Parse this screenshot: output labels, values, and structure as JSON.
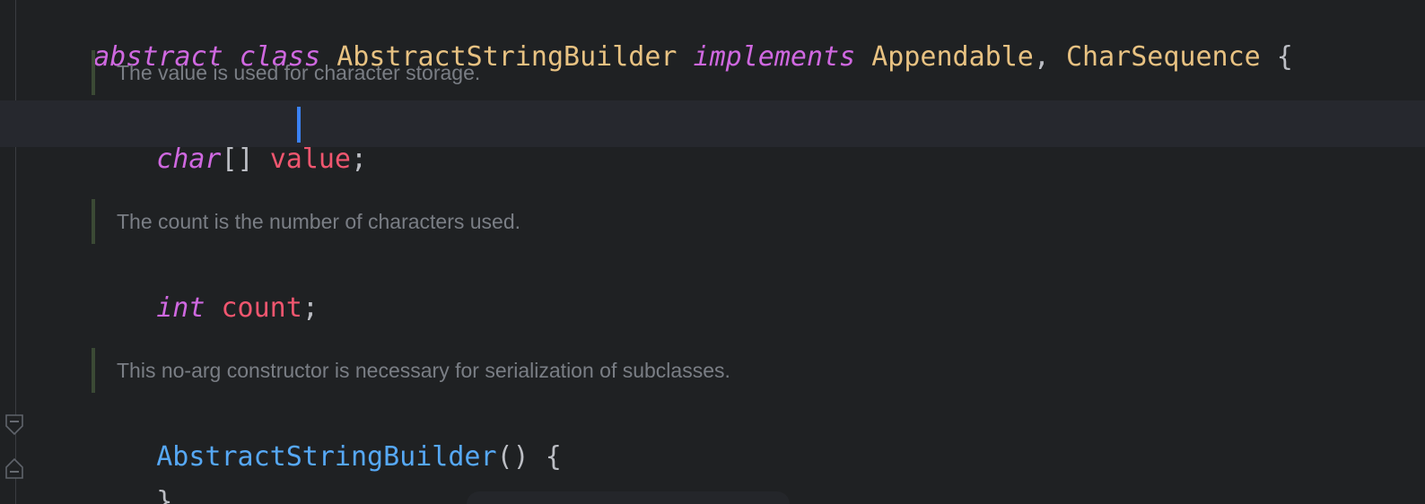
{
  "editor": {
    "line1": {
      "kw1": "abstract",
      "kw2": "class",
      "cls1": "AbstractStringBuilder",
      "kw3": "implements",
      "cls2": "Appendable",
      "comma": ",",
      "cls3": "CharSequence",
      "brace": "{"
    },
    "doc1": "The value is used for character storage.",
    "line2": {
      "type": "char",
      "brackets": "[]",
      "field": "value",
      "semi": ";"
    },
    "doc2": "The count is the number of characters used.",
    "line3": {
      "type": "int",
      "field": "count",
      "semi": ";"
    },
    "doc3": "This no-arg constructor is necessary for serialization of subclasses.",
    "line4": {
      "ctor": "AbstractStringBuilder",
      "parens": "()",
      "brace": "{"
    },
    "line5": {
      "brace": "}"
    }
  },
  "colors": {
    "background": "#1f2123",
    "keyword": "#cf68e0",
    "class": "#e8c282",
    "field": "#f0566f",
    "method": "#56a8f5",
    "doc_text": "#7a7e85",
    "caret": "#3b82f6"
  },
  "icons": [
    "fold-start-icon",
    "fold-end-icon"
  ]
}
